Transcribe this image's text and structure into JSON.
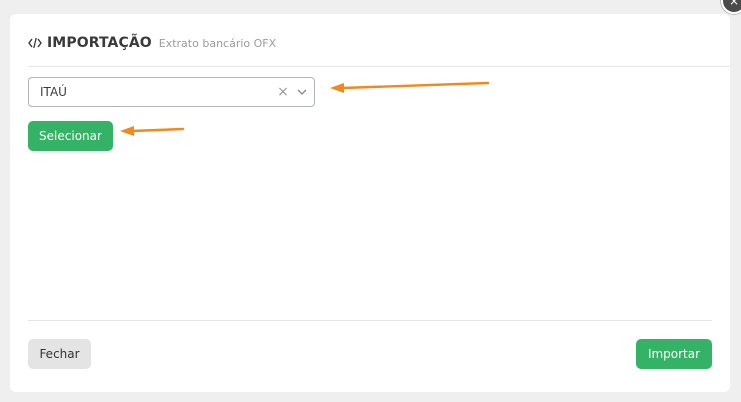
{
  "modal": {
    "title": "IMPORTAÇÃO",
    "subtitle": "Extrato bancário OFX",
    "title_icon": "code-icon"
  },
  "bank_select": {
    "value": "ITAÚ",
    "clear_icon": "×",
    "dropdown_icon": "chevron-down-icon"
  },
  "buttons": {
    "select_label": "Selecionar",
    "close_label": "Fechar",
    "import_label": "Importar"
  },
  "colors": {
    "accent_green": "#34b366",
    "annotation_arrow": "#f08a1c",
    "close_button_bg": "#e4e4e4"
  }
}
